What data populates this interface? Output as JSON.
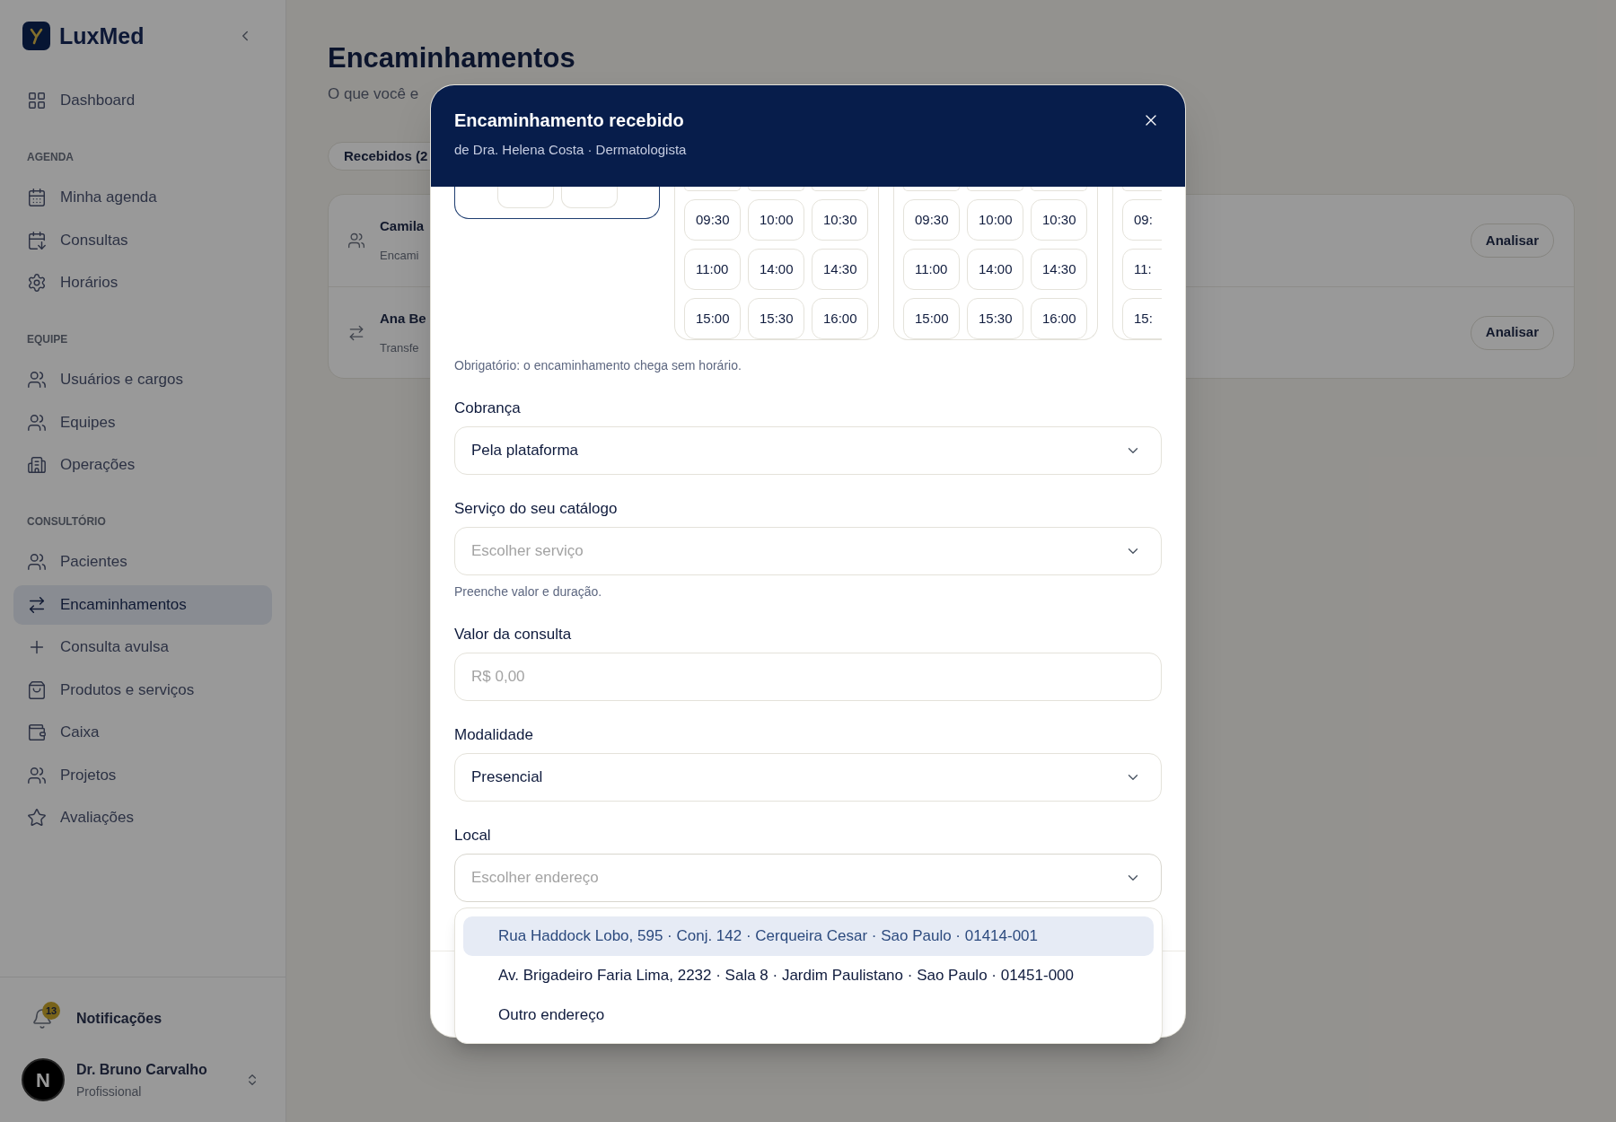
{
  "sidebar": {
    "brand": "LuxMed",
    "sections": [
      {
        "items": [
          {
            "label": "Dashboard",
            "selected": false
          }
        ]
      },
      {
        "heading": "AGENDA",
        "items": [
          {
            "label": "Minha agenda",
            "selected": false
          },
          {
            "label": "Consultas",
            "selected": false
          },
          {
            "label": "Horários",
            "selected": false
          }
        ]
      },
      {
        "heading": "EQUIPE",
        "items": [
          {
            "label": "Usuários e cargos",
            "selected": false
          },
          {
            "label": "Equipes",
            "selected": false
          },
          {
            "label": "Operações",
            "selected": false
          }
        ]
      },
      {
        "heading": "CONSULTÓRIO",
        "items": [
          {
            "label": "Pacientes",
            "selected": false
          },
          {
            "label": "Encaminhamentos",
            "selected": true
          },
          {
            "label": "Consulta avulsa",
            "selected": false
          },
          {
            "label": "Produtos e serviços",
            "selected": false
          },
          {
            "label": "Caixa",
            "selected": false
          },
          {
            "label": "Projetos",
            "selected": false
          },
          {
            "label": "Avaliações",
            "selected": false
          }
        ]
      }
    ],
    "notifications": {
      "label": "Notificações",
      "count": "13"
    },
    "user": {
      "initial": "N",
      "name": "Dr. Bruno Carvalho",
      "role": "Profissional"
    }
  },
  "page": {
    "title": "Encaminhamentos",
    "subtitle": "O que você e",
    "tabs": [
      {
        "label": "Recebidos (2",
        "selected": true
      }
    ],
    "referrals": [
      {
        "name": "Camila",
        "detail": "Encami",
        "action": "Analisar"
      },
      {
        "name": "Ana Be",
        "detail": "Transfe",
        "action": "Analisar"
      }
    ]
  },
  "dialog": {
    "title": "Encaminhamento recebido",
    "subtitle": "de Dra. Helena Costa · Dermatologista",
    "days": [
      {
        "selected": true,
        "rows": [
          [
            {
              "kind": "cut"
            },
            {
              "kind": "cut"
            }
          ]
        ]
      },
      {
        "selected": false,
        "rows": [
          [
            {
              "kind": "cut"
            },
            {
              "kind": "cut"
            },
            {
              "kind": "cut"
            }
          ],
          [
            {
              "kind": "time",
              "label": "09:30"
            },
            {
              "kind": "time",
              "label": "10:00"
            },
            {
              "kind": "time",
              "label": "10:30"
            }
          ],
          [
            {
              "kind": "time",
              "label": "11:00"
            },
            {
              "kind": "time",
              "label": "14:00"
            },
            {
              "kind": "time",
              "label": "14:30"
            }
          ],
          [
            {
              "kind": "time",
              "label": "15:00"
            },
            {
              "kind": "time",
              "label": "15:30"
            },
            {
              "kind": "time",
              "label": "16:00"
            }
          ]
        ]
      },
      {
        "selected": false,
        "rows": [
          [
            {
              "kind": "cut"
            },
            {
              "kind": "cut"
            },
            {
              "kind": "cut"
            }
          ],
          [
            {
              "kind": "time",
              "label": "09:30"
            },
            {
              "kind": "time",
              "label": "10:00"
            },
            {
              "kind": "time",
              "label": "10:30"
            }
          ],
          [
            {
              "kind": "time",
              "label": "11:00"
            },
            {
              "kind": "time",
              "label": "14:00"
            },
            {
              "kind": "time",
              "label": "14:30"
            }
          ],
          [
            {
              "kind": "time",
              "label": "15:00"
            },
            {
              "kind": "time",
              "label": "15:30"
            },
            {
              "kind": "time",
              "label": "16:00"
            }
          ]
        ]
      },
      {
        "selected": false,
        "rows": [
          [
            {
              "kind": "cut"
            }
          ],
          [
            {
              "kind": "time",
              "label": "09:"
            }
          ],
          [
            {
              "kind": "time",
              "label": "11:"
            }
          ],
          [
            {
              "kind": "time",
              "label": "15:"
            }
          ]
        ]
      }
    ],
    "slots_note": "Obrigatório: o encaminhamento chega sem horário.",
    "fields": [
      {
        "kind": "select",
        "label": "Cobrança",
        "value": "Pela plataforma",
        "expanded": false
      },
      {
        "kind": "select",
        "label": "Serviço do seu catálogo",
        "placeholder": "Escolher serviço",
        "hint": "Preenche valor e duração.",
        "expanded": false
      },
      {
        "kind": "input",
        "label": "Valor da consulta",
        "placeholder": "R$ 0,00"
      },
      {
        "kind": "select",
        "label": "Modalidade",
        "value": "Presencial",
        "expanded": false
      },
      {
        "kind": "select",
        "label": "Local",
        "placeholder": "Escolher endereço",
        "expanded": true
      }
    ],
    "address_options": [
      {
        "label": "Rua Haddock Lobo, 595 · Conj. 142 · Cerqueira Cesar · Sao Paulo · 01414-001",
        "selected": true
      },
      {
        "label": "Av. Brigadeiro Faria Lima, 2232 · Sala 8 · Jardim Paulistano · Sao Paulo · 01451-000",
        "selected": false
      },
      {
        "label": "Outro endereço",
        "selected": false
      }
    ]
  }
}
